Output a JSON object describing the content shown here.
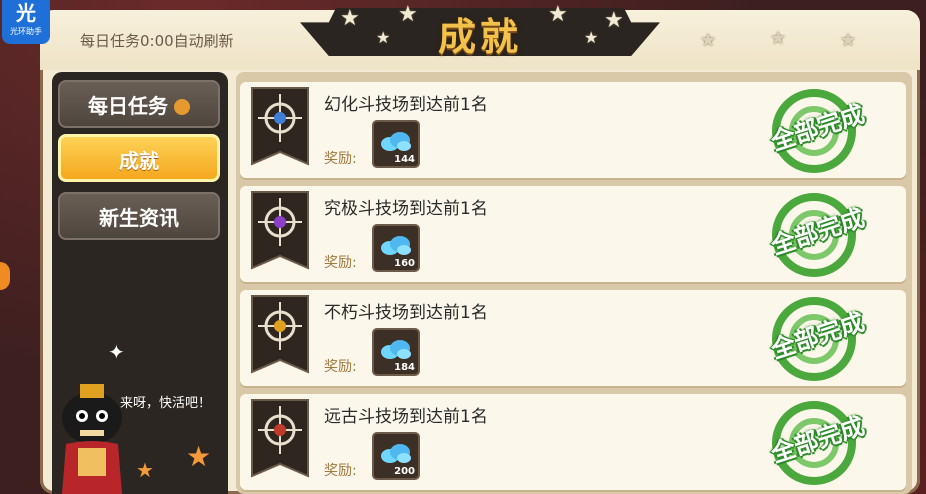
{
  "logo": {
    "glyph": "光",
    "text": "光环助手"
  },
  "header": {
    "refresh_text": "每日任务0:00自动刷新",
    "title": "成就"
  },
  "tabs": [
    {
      "label": "每日任务",
      "active": false
    },
    {
      "label": "成就",
      "active": true
    },
    {
      "label": "新生资讯",
      "active": false
    }
  ],
  "achievements": [
    {
      "task": "幻化斗技场到达前1名",
      "reward_label": "奖励:",
      "reward_qty": "144",
      "status": "全部完成",
      "emblem_color": "#3f7fd6"
    },
    {
      "task": "究极斗技场到达前1名",
      "reward_label": "奖励:",
      "reward_qty": "160",
      "status": "全部完成",
      "emblem_color": "#8a3fc6"
    },
    {
      "task": "不朽斗技场到达前1名",
      "reward_label": "奖励:",
      "reward_qty": "184",
      "status": "全部完成",
      "emblem_color": "#e0a020"
    },
    {
      "task": "远古斗技场到达前1名",
      "reward_label": "奖励:",
      "reward_qty": "200",
      "status": "全部完成",
      "emblem_color": "#c03a2a"
    }
  ],
  "mascot": {
    "speech": "来呀，快活吧！"
  },
  "colors": {
    "accent": "#f5a81e",
    "complete": "#4aa83c",
    "panel": "#f3ebd4"
  }
}
